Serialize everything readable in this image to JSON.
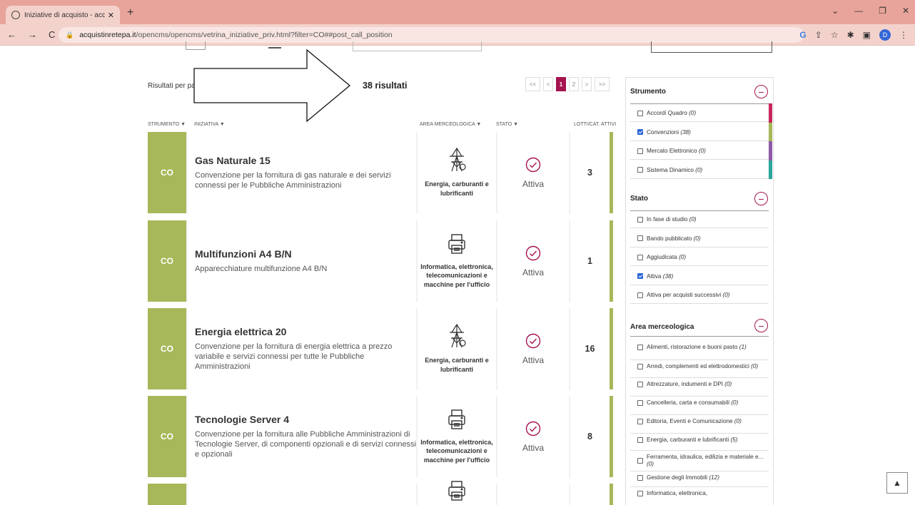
{
  "browser": {
    "tab_title": "Iniziative di acquisto - acquistinr",
    "url_domain": "acquistinretepa.it",
    "url_path": "/opencms/opencms/vetrina_iniziative_priv.html?filter=CO##post_call_position"
  },
  "results": {
    "per_page_label": "Risultati per pa",
    "count_label": "38 risultati"
  },
  "pager": {
    "first": "<<",
    "prev": "<",
    "current": "1",
    "next_page": "2",
    "next": ">",
    "last": ">>"
  },
  "table_headers": {
    "strumento": "STRUMENTO ▼",
    "iniziativa": "INIZIATIVA ▼",
    "area": "AREA MERCEOLOGICA ▼",
    "stato": "STATO ▼",
    "lotti": "LOTTI/CAT. ATTIVI"
  },
  "rows": [
    {
      "code": "CO",
      "title": "Gas Naturale 15",
      "desc": "Convenzione per la fornitura di gas naturale e dei servizi connessi per le Pubbliche Amministrazioni",
      "area": "Energia, carburanti e lubrificanti",
      "area_icon": "energy-tower-icon",
      "stato": "Attiva",
      "lotti": "3"
    },
    {
      "code": "CO",
      "title": "Multifunzioni A4 B/N",
      "desc": "Apparecchiature multifunzione A4 B/N",
      "area": "Informatica, elettronica, telecomunicazioni e macchine per l'ufficio",
      "area_icon": "printer-icon",
      "stato": "Attiva",
      "lotti": "1"
    },
    {
      "code": "CO",
      "title": "Energia elettrica 20",
      "desc": "Convenzione per la fornitura di energia elettrica a prezzo variabile e servizi connessi per tutte le Pubbliche Amministrazioni",
      "area": "Energia, carburanti e lubrificanti",
      "area_icon": "energy-tower-icon",
      "stato": "Attiva",
      "lotti": "16"
    },
    {
      "code": "CO",
      "title": "Tecnologie Server 4",
      "desc": "Convenzione per la fornitura alle Pubbliche Amministrazioni di Tecnologie Server, di componenti opzionali e di servizi connessi e opzionali",
      "area": "Informatica, elettronica, telecomunicazioni e macchine per l'ufficio",
      "area_icon": "printer-icon",
      "stato": "Attiva",
      "lotti": "8"
    }
  ],
  "sidebar": {
    "strumento": {
      "title": "Strumento",
      "items": [
        {
          "label": "Accordi Quadro",
          "count": "(0)",
          "checked": false,
          "color": "#c8275e"
        },
        {
          "label": "Convenzioni",
          "count": "(38)",
          "checked": true,
          "color": "#a7b85a"
        },
        {
          "label": "Mercato Elettronico",
          "count": "(0)",
          "checked": false,
          "color": "#8e5aa8"
        },
        {
          "label": "Sistema Dinamico",
          "count": "(0)",
          "checked": false,
          "color": "#2aa79b"
        }
      ]
    },
    "stato": {
      "title": "Stato",
      "items": [
        {
          "label": "In fase di studio",
          "count": "(0)",
          "checked": false
        },
        {
          "label": "Bando pubblicato",
          "count": "(0)",
          "checked": false
        },
        {
          "label": "Aggiudicata",
          "count": "(0)",
          "checked": false
        },
        {
          "label": "Attiva",
          "count": "(38)",
          "checked": true
        },
        {
          "label": "Attiva per acquisti successivi",
          "count": "(0)",
          "checked": false
        }
      ]
    },
    "area": {
      "title": "Area merceologica",
      "items": [
        {
          "label": "Alimenti, ristorazione e buoni pasto",
          "count": "(1)",
          "checked": false
        },
        {
          "label": "Arredi, complementi ed elettrodomestici",
          "count": "(0)",
          "checked": false
        },
        {
          "label": "Attrezzature, indumenti e DPI",
          "count": "(0)",
          "checked": false
        },
        {
          "label": "Cancelleria, carta e consumabili",
          "count": "(0)",
          "checked": false
        },
        {
          "label": "Editoria, Eventi e Comunicazione",
          "count": "(0)",
          "checked": false
        },
        {
          "label": "Energia, carburanti e lubrificanti",
          "count": "(5)",
          "checked": false
        },
        {
          "label": "Ferramenta, idraulica, edilizia e materiale e...",
          "count": "(0)",
          "checked": false
        },
        {
          "label": "Gestione degli Immobili",
          "count": "(12)",
          "checked": false
        },
        {
          "label": "Informatica, elettronica,",
          "count": "",
          "checked": false
        }
      ]
    }
  },
  "icons": {
    "check_circle": "check-circle-icon",
    "scroll_top": "chevron-up-icon",
    "accent": "#a6134f",
    "co_color": "#a7b85a"
  }
}
